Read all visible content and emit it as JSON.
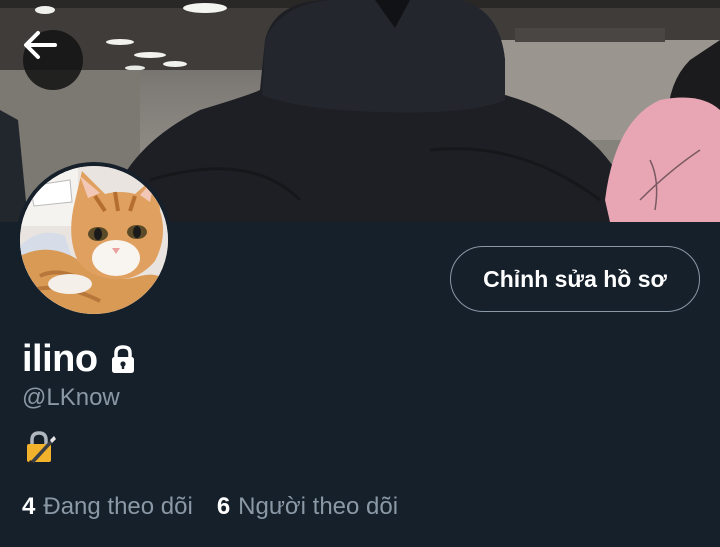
{
  "header": {
    "back_icon": "arrow-left-icon",
    "banner_image": "person in dark hoodie, mall interior"
  },
  "profile": {
    "avatar_image": "orange tabby cat",
    "edit_button_label": "Chỉnh sửa hồ sơ",
    "display_name": "ilino",
    "protected_icon": "lock-icon",
    "handle": "@LKnow",
    "bio_icon": "locked-with-pen-emoji"
  },
  "stats": {
    "following_count": "4",
    "following_label": "Đang theo dõi",
    "followers_count": "6",
    "followers_label": "Người theo dõi"
  },
  "colors": {
    "background": "#15202b",
    "secondary_text": "#8b98a5",
    "border": "#8b98a5"
  }
}
